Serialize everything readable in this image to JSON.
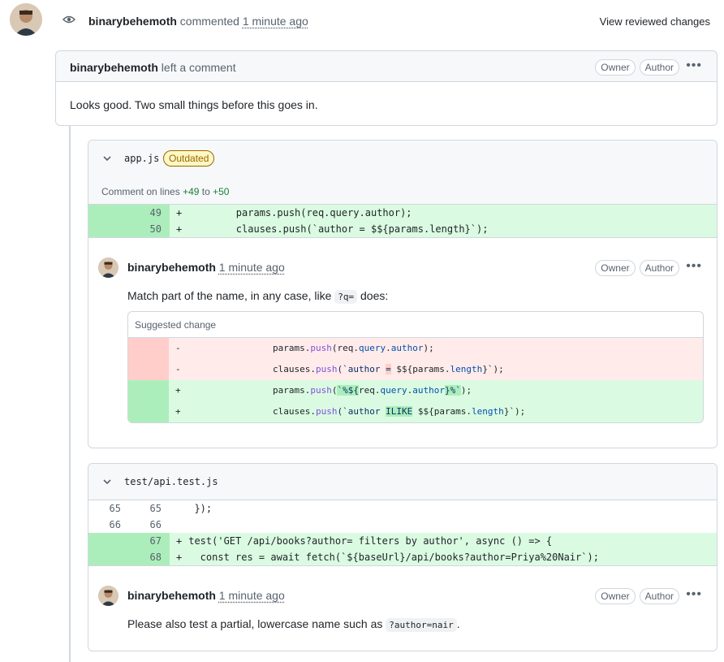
{
  "event": {
    "user": "binarybehemoth",
    "action": "commented",
    "time": "1 minute ago",
    "view_reviewed": "View reviewed changes"
  },
  "review": {
    "user": "binarybehemoth",
    "action": "left a comment",
    "badges": [
      "Owner",
      "Author"
    ],
    "body": "Looks good. Two small things before this goes in."
  },
  "thread1": {
    "filename": "app.js",
    "status": "Outdated",
    "comment_on": {
      "prefix": "Comment on lines",
      "from": "+49",
      "to_word": "to",
      "to": "+50"
    },
    "diff": [
      {
        "new": "49",
        "sign": "+",
        "code": "        params.push(req.query.author);"
      },
      {
        "new": "50",
        "sign": "+",
        "code": "        clauses.push(`author = $${params.length}`);"
      }
    ],
    "comment": {
      "user": "binarybehemoth",
      "time": "1 minute ago",
      "badges": [
        "Owner",
        "Author"
      ],
      "text_before": "Match part of the name, in any case, like",
      "code": "?q=",
      "text_after": "does:"
    },
    "suggestion": {
      "title": "Suggested change",
      "del": [
        {
          "sign": "-",
          "pre": "        params.",
          "fn": "push",
          "mid": "(req.",
          "prop": "query",
          "dot": ".",
          "prop2": "author",
          "post": ");"
        },
        {
          "sign": "-",
          "pre": "        clauses.",
          "fn": "push",
          "mid": "(`author ",
          "hl": "=",
          "post1": " $${params.",
          "prop": "length",
          "post2": "}`);"
        }
      ],
      "add": [
        {
          "sign": "+",
          "pre": "        params.",
          "fn": "push",
          "mid": "(",
          "hl1": "`%${",
          "mid2": "req.",
          "prop": "query",
          "dot": ".",
          "prop2": "author",
          "hl2": "}%`",
          "post": ");"
        },
        {
          "sign": "+",
          "pre": "        clauses.",
          "fn": "push",
          "mid": "(`author ",
          "hl": "ILIKE",
          "post1": " $${params.",
          "prop": "length",
          "post2": "}`);"
        }
      ]
    }
  },
  "thread2": {
    "filename": "test/api.test.js",
    "diff": [
      {
        "old": "65",
        "new": "65",
        "sign": " ",
        "code": "  });",
        "type": "ctx"
      },
      {
        "old": "66",
        "new": "66",
        "sign": " ",
        "code": "",
        "type": "ctx"
      },
      {
        "old": "",
        "new": "67",
        "sign": "+",
        "code": " test('GET /api/books?author= filters by author', async () => {",
        "type": "add"
      },
      {
        "old": "",
        "new": "68",
        "sign": "+",
        "code": "   const res = await fetch(`${baseUrl}/api/books?author=Priya%20Nair`);",
        "type": "add"
      }
    ],
    "comment": {
      "user": "binarybehemoth",
      "time": "1 minute ago",
      "badges": [
        "Owner",
        "Author"
      ],
      "text_before": "Please also test a partial, lowercase name such as",
      "code": "?author=nair",
      "text_after": "."
    }
  }
}
